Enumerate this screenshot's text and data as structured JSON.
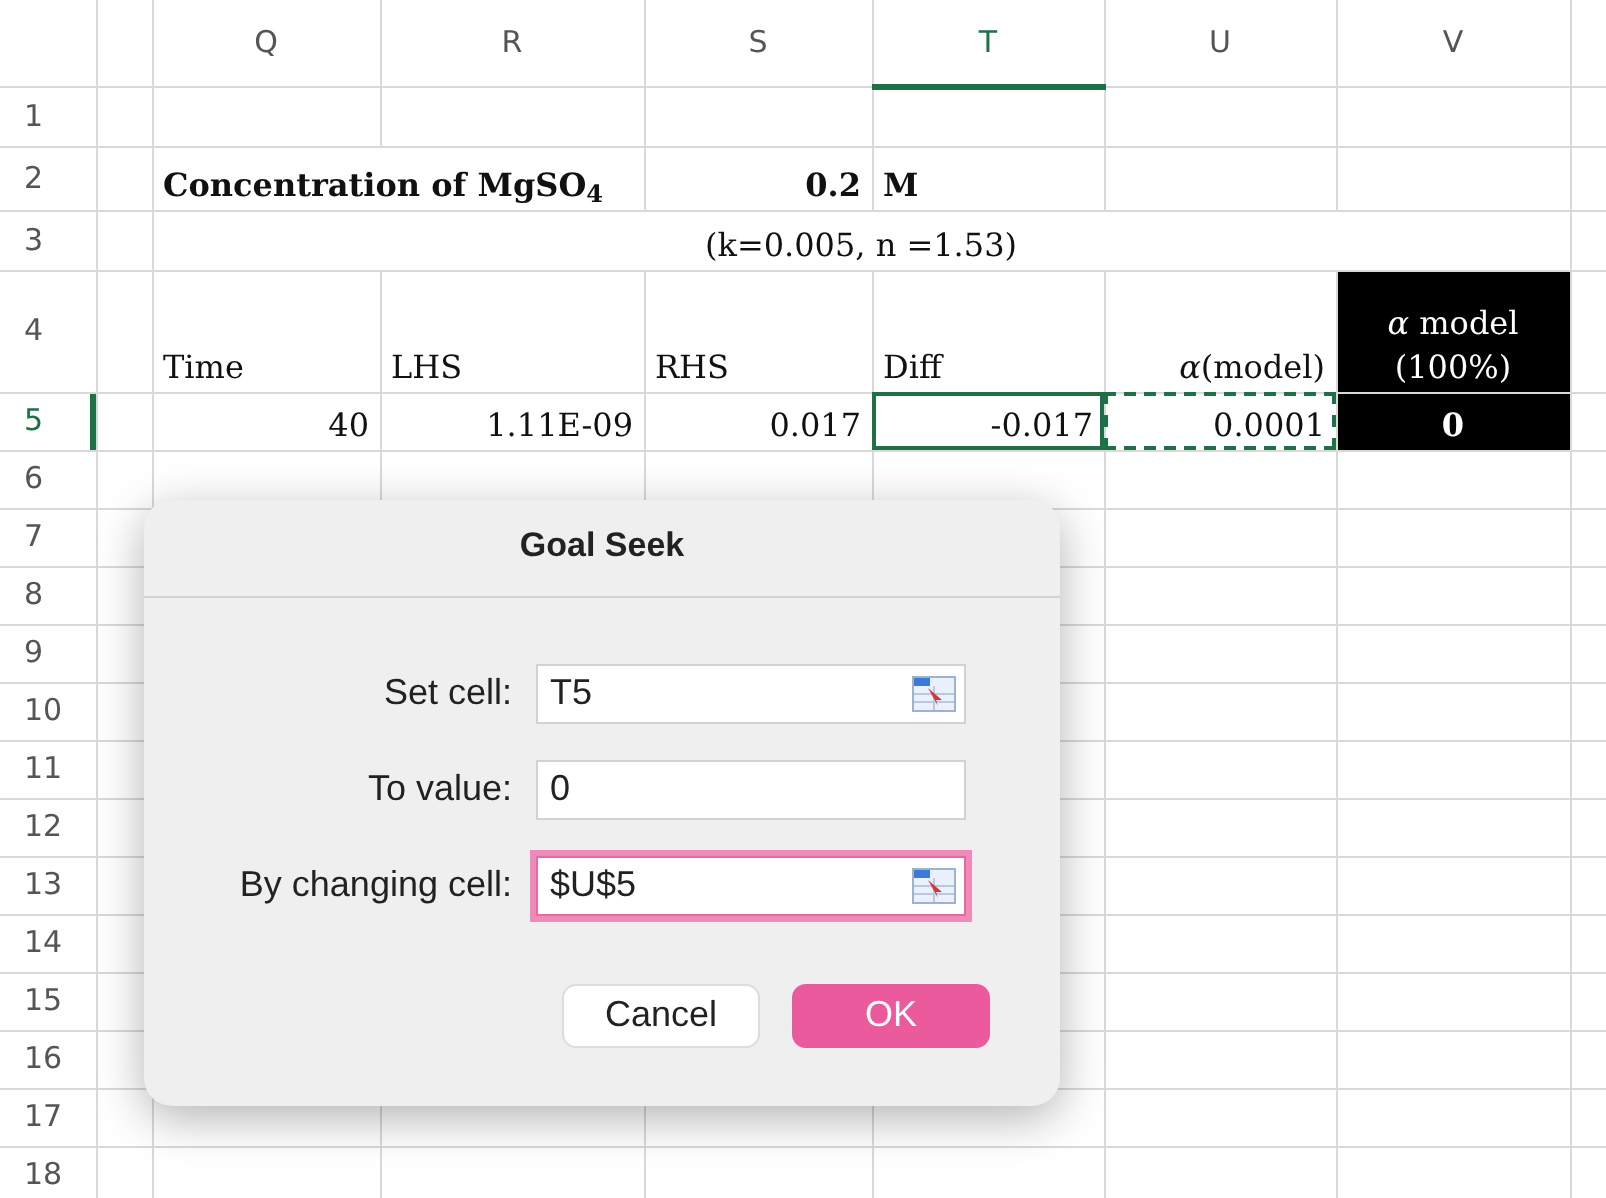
{
  "spreadsheet": {
    "columns": [
      {
        "label": "Q",
        "selected": false
      },
      {
        "label": "R",
        "selected": false
      },
      {
        "label": "S",
        "selected": false
      },
      {
        "label": "T",
        "selected": true
      },
      {
        "label": "U",
        "selected": false
      },
      {
        "label": "V",
        "selected": false
      }
    ],
    "rows": [
      {
        "number": "1",
        "selected": false,
        "cells": [
          "",
          "",
          "",
          "",
          "",
          ""
        ]
      },
      {
        "number": "2",
        "selected": false,
        "cells": [
          {
            "text": "Concentration of MgSO$_{4}$",
            "kind": "left",
            "bold": true,
            "colspan": 2
          },
          {
            "text": "0.2",
            "kind": "right",
            "bold": true
          },
          {
            "text": "M",
            "kind": "left",
            "bold": true
          },
          "",
          ""
        ]
      },
      {
        "number": "3",
        "selected": false,
        "cells": [
          {
            "text": "(k=0.005, n =1.53)",
            "kind": "center",
            "colspan": 6
          }
        ]
      },
      {
        "number": "4",
        "selected": false,
        "cells": [
          {
            "text": "Time",
            "kind": "left"
          },
          {
            "text": "LHS",
            "kind": "left"
          },
          {
            "text": "RHS",
            "kind": "left"
          },
          {
            "text": "Diff",
            "kind": "left"
          },
          {
            "text": "*α*(model)",
            "kind": "right"
          },
          {
            "text": "*α* model (100%)",
            "kind": "center",
            "inverted": true
          }
        ]
      },
      {
        "number": "5",
        "selected": true,
        "cells": [
          {
            "text": "40",
            "kind": "right"
          },
          {
            "text": "1.11E-09",
            "kind": "right"
          },
          {
            "text": "0.017",
            "kind": "right"
          },
          {
            "text": "-0.017",
            "kind": "right",
            "active": true
          },
          {
            "text": "0.0001",
            "kind": "right",
            "marquee": true
          },
          {
            "text": "0",
            "kind": "center",
            "inverted": true,
            "bold": true
          }
        ]
      },
      {
        "number": "6",
        "selected": false,
        "cells": [
          "",
          "",
          "",
          "",
          "",
          ""
        ]
      },
      {
        "number": "7",
        "selected": false,
        "cells": [
          "",
          "",
          "",
          "",
          "",
          ""
        ]
      },
      {
        "number": "8",
        "selected": false,
        "cells": [
          "",
          "",
          "",
          "",
          "",
          ""
        ]
      },
      {
        "number": "9",
        "selected": false,
        "cells": [
          "",
          "",
          "",
          "",
          "",
          ""
        ]
      },
      {
        "number": "10",
        "selected": false,
        "cells": [
          "",
          "",
          "",
          "",
          "",
          ""
        ]
      },
      {
        "number": "11",
        "selected": false,
        "cells": [
          "",
          "",
          "",
          "",
          "",
          ""
        ]
      },
      {
        "number": "12",
        "selected": false,
        "cells": [
          "",
          "",
          "",
          "",
          "",
          ""
        ]
      },
      {
        "number": "13",
        "selected": false,
        "cells": [
          "",
          "",
          "",
          "",
          "",
          ""
        ]
      },
      {
        "number": "14",
        "selected": false,
        "cells": [
          "",
          "",
          "",
          "",
          "",
          ""
        ]
      },
      {
        "number": "15",
        "selected": false,
        "cells": [
          "",
          "",
          "",
          "",
          "",
          ""
        ]
      },
      {
        "number": "16",
        "selected": false,
        "cells": [
          "",
          "",
          "",
          "",
          "",
          ""
        ]
      },
      {
        "number": "17",
        "selected": false,
        "cells": [
          "",
          "",
          "",
          "",
          "",
          ""
        ]
      },
      {
        "number": "18",
        "selected": false,
        "cells": [
          "",
          "",
          "",
          "",
          "",
          ""
        ]
      }
    ]
  },
  "dialog": {
    "title": "Goal Seek",
    "fields": [
      {
        "label": "Set cell:",
        "value": "T5",
        "focused": false,
        "picker": true
      },
      {
        "label": "To value:",
        "value": "0",
        "focused": false,
        "picker": false
      },
      {
        "label": "By changing cell:",
        "value": "$U$5",
        "focused": true,
        "picker": true
      }
    ],
    "buttons": [
      {
        "label": "Cancel",
        "default": false
      },
      {
        "label": "OK",
        "default": true
      }
    ]
  }
}
